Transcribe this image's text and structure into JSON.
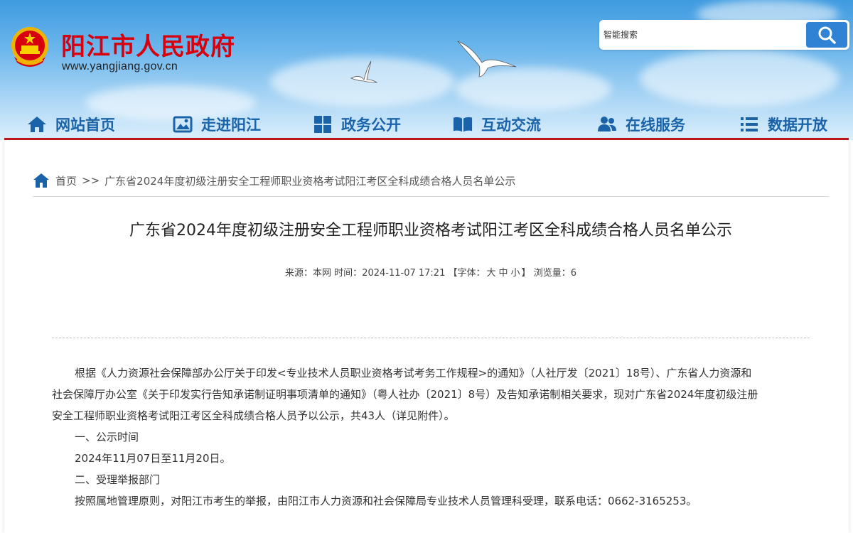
{
  "header": {
    "site_name": "阳江市人民政府",
    "site_url": "www.yangjiang.gov.cn",
    "search_placeholder": "智能搜索",
    "colors": {
      "brand_red": "#d7000f",
      "nav_blue": "#1b63a8",
      "accent_line": "#c4161c",
      "search_button": "#2f82d4"
    }
  },
  "nav": {
    "items": [
      {
        "label": "网站首页",
        "icon": "home-icon"
      },
      {
        "label": "走进阳江",
        "icon": "picture-icon"
      },
      {
        "label": "政务公开",
        "icon": "grid-icon"
      },
      {
        "label": "互动交流",
        "icon": "book-icon"
      },
      {
        "label": "在线服务",
        "icon": "users-icon"
      },
      {
        "label": "数据开放",
        "icon": "list-icon"
      }
    ]
  },
  "breadcrumb": {
    "home": "首页",
    "separator": ">>",
    "current": "广东省2024年度初级注册安全工程师职业资格考试阳江考区全科成绩合格人员名单公示"
  },
  "article": {
    "title": "广东省2024年度初级注册安全工程师职业资格考试阳江考区全科成绩合格人员名单公示",
    "meta": {
      "source_label": "来源：",
      "source": "本网",
      "time_label": "时间：",
      "time": "2024-11-07 17:21",
      "font_open": "【字体：",
      "font_large": "大",
      "font_medium": "中",
      "font_small": "小",
      "font_close": "】",
      "views_label": "浏览量：",
      "views": "6"
    },
    "paragraphs": {
      "p1_l1": "根据《人力资源社会保障部办公厅关于印发<专业技术人员职业资格考试考务工作规程>的通知》（人社厅发〔2021〕18号）、广东省人力资源和",
      "p1_l2": "社会保障厅办公室《关于印发实行告知承诺制证明事项清单的通知》（粤人社办〔2021〕8号）及告知承诺制相关要求，现对广东省2024年度初级注册",
      "p1_l3": "安全工程师职业资格考试阳江考区全科成绩合格人员予以公示，共43人（详见附件）。",
      "s1_title": "一、公示时间",
      "s1_body": "2024年11月07日至11月20日。",
      "s2_title": "二、受理举报部门",
      "s2_body": "按照属地管理原则，对阳江市考生的举报，由阳江市人力资源和社会保障局专业技术人员管理科受理，联系电话：0662-3165253。"
    }
  }
}
